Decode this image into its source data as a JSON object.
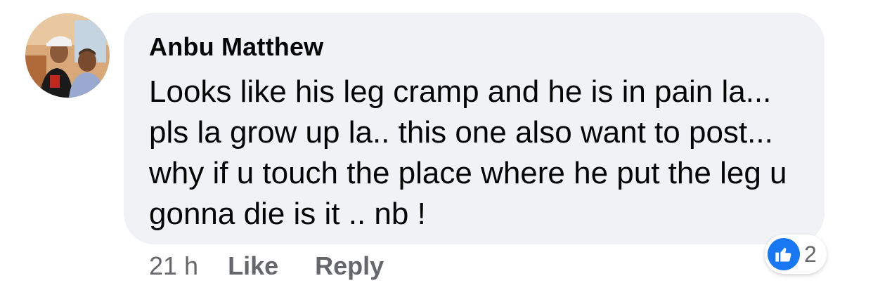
{
  "comment": {
    "author": "Anbu Matthew",
    "text": "Looks like his leg cramp and he is in pain la... pls la grow up la.. this one also want to post... why if u touch the place where he put the leg u gonna die is it ..  nb !",
    "timestamp": "21 h",
    "actions": {
      "like_label": "Like",
      "reply_label": "Reply"
    },
    "reactions": {
      "icon": "like-thumbs-up-icon",
      "count": "2"
    }
  },
  "colors": {
    "bubble_background": "#f0f2f5",
    "text_primary": "#050505",
    "text_secondary": "#65676b",
    "like_blue": "#1877f2"
  }
}
